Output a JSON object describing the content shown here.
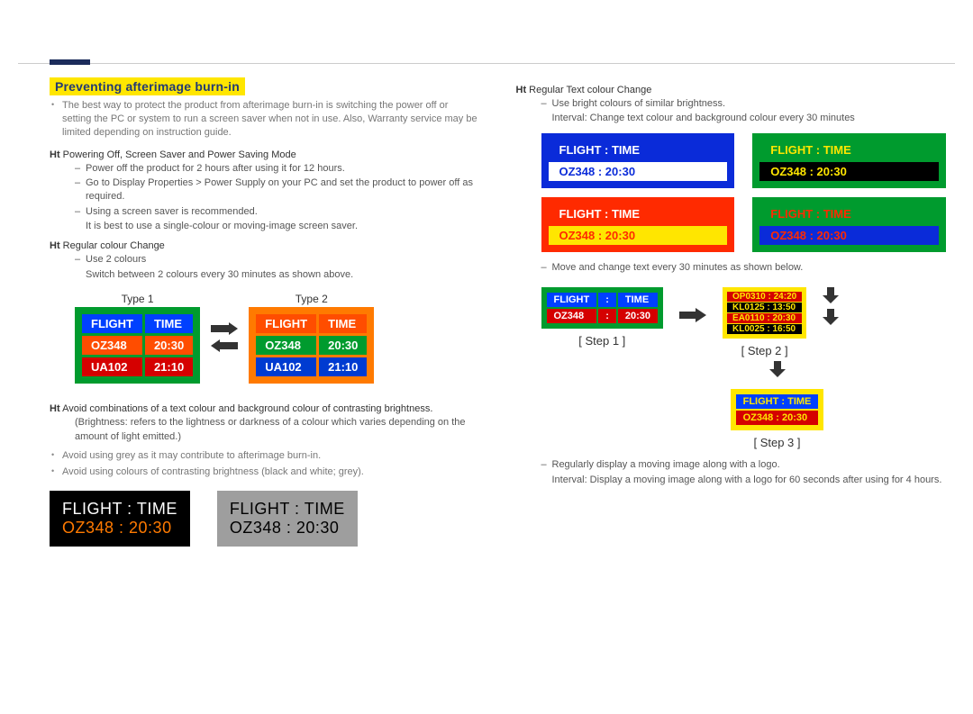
{
  "header": {
    "section_title": "Preventing afterimage burn-in"
  },
  "left": {
    "intro": "The best way to protect the product from afterimage burn-in is switching the power off or setting the PC or system to run a screen saver when not in use. Also, Warranty service may be limited depending on instruction guide.",
    "ht1_label": "Ht",
    "ht1_title": "Powering Off, Screen Saver and Power Saving Mode",
    "ht1_items": {
      "a": "Power off the product for 2 hours after using it for 12 hours.",
      "b": "Go to Display Properties > Power Supply on your PC and set the product to power off as required.",
      "c": "Using a screen saver is recommended.",
      "c_note": "It is best to use a single-colour or moving-image screen saver."
    },
    "ht2_label": "Ht",
    "ht2_title": "Regular colour Change",
    "ht2_items": {
      "a": "Use 2 colours",
      "a_note": "Switch between 2 colours every 30 minutes as shown above."
    },
    "type1_label": "Type 1",
    "type2_label": "Type 2",
    "flight_headers": {
      "c1": "FLIGHT",
      "c2": "TIME"
    },
    "flight_rows": {
      "r1": {
        "c1": "OZ348",
        "c2": "20:30"
      },
      "r2": {
        "c1": "UA102",
        "c2": "21:10"
      }
    },
    "ht3_label": "Ht",
    "ht3_title": "Avoid combinations of a text colour and background colour of contrasting brightness.",
    "ht3_note": "(Brightness: refers to the lightness or darkness of a colour which varies depending on the amount of light emitted.)",
    "avoid1": "Avoid using grey as it may contribute to afterimage burn-in.",
    "avoid2": "Avoid using colours of contrasting brightness (black and white; grey).",
    "box_l1": "FLIGHT   :   TIME",
    "box_l2": "OZ348   :   20:30"
  },
  "right": {
    "ht4_label": "Ht",
    "ht4_title": "Regular Text colour Change",
    "ht4_a": "Use bright colours of similar brightness.",
    "ht4_a_note": "Interval: Change text colour and background colour every 30 minutes",
    "tile_h": "FLIGHT   :   TIME",
    "tile_r": "OZ348   :   20:30",
    "ht4_b": "Move and change text every 30 minutes as shown below.",
    "step1_h": {
      "c1": "FLIGHT",
      "sep": ":",
      "c2": "TIME"
    },
    "step1_r": {
      "c1": "OZ348",
      "sep": ":",
      "c2": "20:30"
    },
    "step2_rows": {
      "a": "OP0310   :   24:20",
      "b": "KL0125   :   13:50",
      "c": "EA0110   :   20:30",
      "d": "KL0025   :   16:50"
    },
    "step_labels": {
      "s1": "[ Step 1 ]",
      "s2": "[ Step 2 ]",
      "s3": "[ Step 3 ]"
    },
    "ht4_c": "Regularly display a moving image along with a logo.",
    "ht4_c_note": "Interval: Display a moving image along with a logo for 60 seconds after using for 4 hours."
  }
}
